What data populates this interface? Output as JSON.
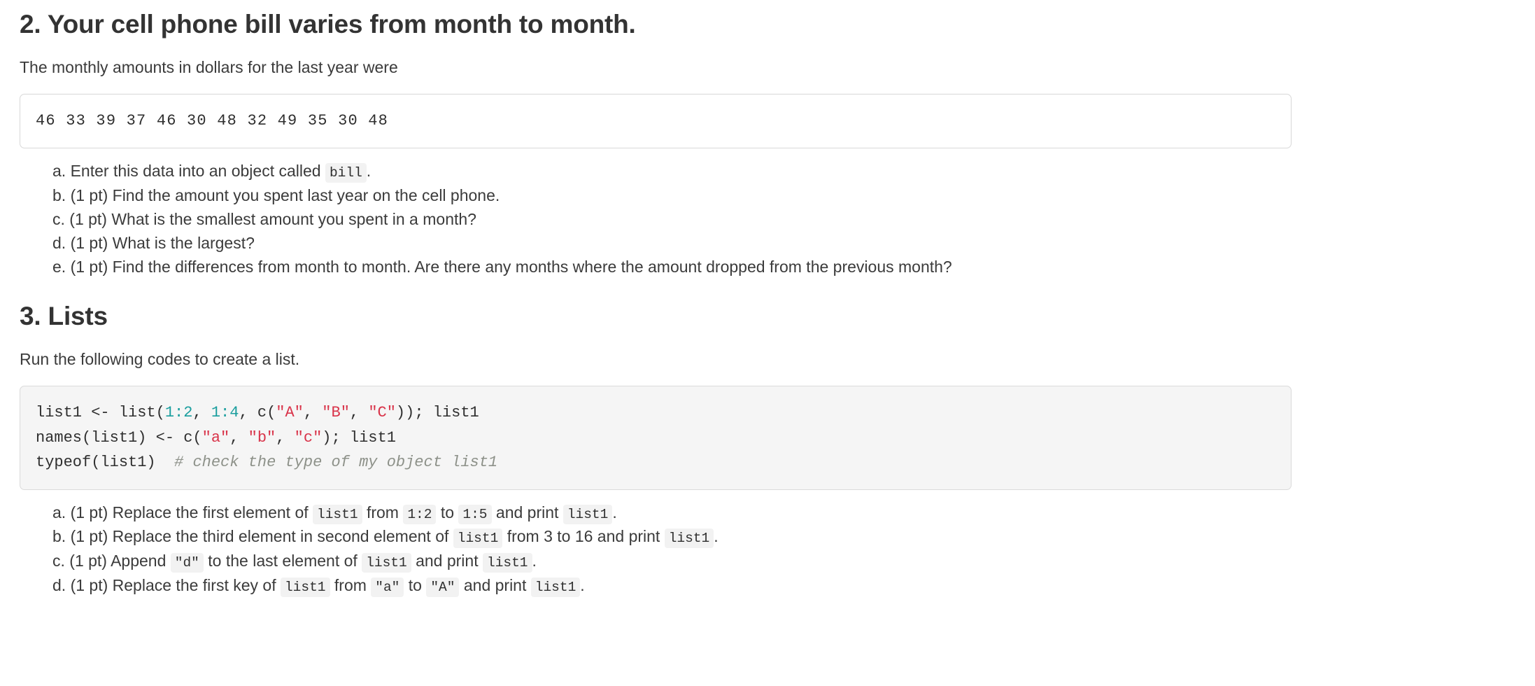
{
  "section2": {
    "heading": "2. Your cell phone bill varies from month to month.",
    "lead": "The monthly amounts in dollars for the last year were",
    "data_block": "46 33 39 37 46 30 48 32 49 35 30 48",
    "items": [
      {
        "marker": "a.",
        "part1": "Enter this data into an object called",
        "code1": "bill",
        "part2": "."
      },
      {
        "marker": "b.",
        "part1": "(1 pt) Find the amount you spent last year on the cell phone."
      },
      {
        "marker": "c.",
        "part1": "(1 pt) What is the smallest amount you spent in a month?"
      },
      {
        "marker": "d.",
        "part1": "(1 pt) What is the largest?"
      },
      {
        "marker": "e.",
        "part1": "(1 pt) Find the differences from month to month. Are there any months where the amount dropped from the previous month?"
      }
    ]
  },
  "section3": {
    "heading": "3. Lists",
    "lead": "Run the following codes to create a list.",
    "code": {
      "line1": {
        "a": "list1 <- list(",
        "n1": "1:2",
        "b": ", ",
        "n2": "1:4",
        "c": ", c(",
        "s1": "\"A\"",
        "d": ", ",
        "s2": "\"B\"",
        "e": ", ",
        "s3": "\"C\"",
        "f": ")); list1"
      },
      "line2": {
        "a": "names(list1) <- c(",
        "s1": "\"a\"",
        "b": ", ",
        "s2": "\"b\"",
        "c": ", ",
        "s3": "\"c\"",
        "d": "); list1"
      },
      "line3": {
        "a": "typeof(list1)  ",
        "comment": "# check the type of my object list1"
      }
    },
    "items": [
      {
        "marker": "a.",
        "part1": "(1 pt) Replace the first element of",
        "code1": "list1",
        "part2": "from",
        "code2": "1:2",
        "part3": "to",
        "code3": "1:5",
        "part4": "and print",
        "code4": "list1",
        "part5": "."
      },
      {
        "marker": "b.",
        "part1": "(1 pt) Replace the third element in second element of",
        "code1": "list1",
        "part2": "from 3 to 16 and print",
        "code2": "list1",
        "part3": "."
      },
      {
        "marker": "c.",
        "part1": "(1 pt) Append",
        "code1": "\"d\"",
        "part2": "to the last element of",
        "code2": "list1",
        "part3": "and print",
        "code3": "list1",
        "part4": "."
      },
      {
        "marker": "d.",
        "part1": "(1 pt) Replace the first key of",
        "code1": "list1",
        "part2": "from",
        "code2": "\"a\"",
        "part3": "to",
        "code3": "\"A\"",
        "part4": "and print",
        "code4": "list1",
        "part5": "."
      }
    ]
  },
  "colors": {
    "text": "#333333",
    "number_token": "#1a9e9e",
    "string_token": "#d9344a",
    "comment_token": "#8d9189",
    "code_bg": "#f5f5f5",
    "inline_code_bg": "#f2f2f2",
    "border": "#d8d8d8"
  }
}
